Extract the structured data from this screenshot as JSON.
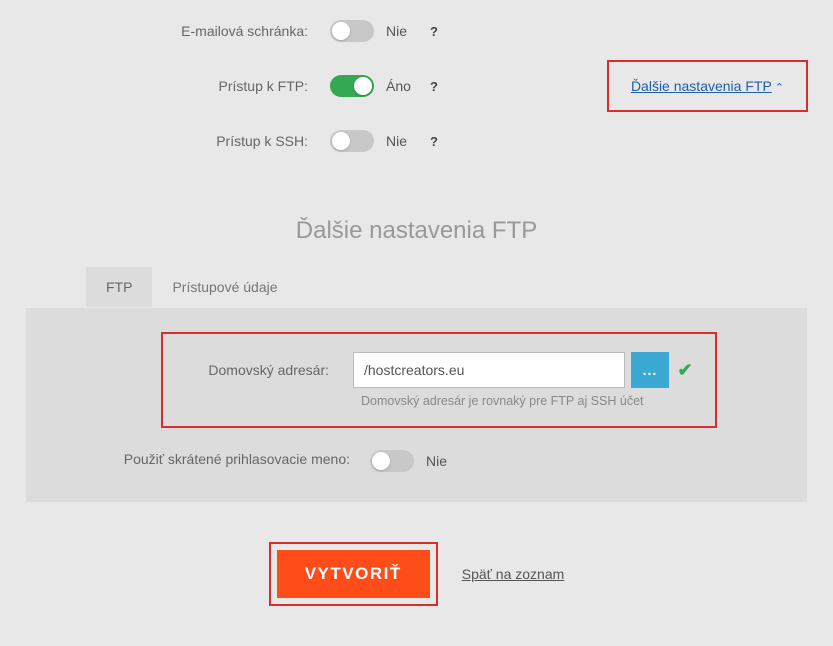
{
  "top": {
    "email_label": "E-mailová schránka:",
    "ftp_label": "Prístup k FTP:",
    "ssh_label": "Prístup k SSH:",
    "yes": "Áno",
    "no": "Nie",
    "more_ftp_link": "Ďalšie nastavenia FTP"
  },
  "ftp_section": {
    "title": "Ďalšie nastavenia FTP",
    "tab_ftp": "FTP",
    "tab_access": "Prístupové údaje",
    "home_dir_label": "Domovský adresár:",
    "home_dir_value": "/hostcreators.eu",
    "home_dir_helper": "Domovský adresár je rovnaký pre FTP aj SSH účet",
    "short_login_label": "Použiť skrátené prihlasovacie meno:",
    "short_login_value": "Nie",
    "dots": "..."
  },
  "footer": {
    "create_btn": "VYTVORIŤ",
    "back_link": "Späť na zoznam"
  }
}
